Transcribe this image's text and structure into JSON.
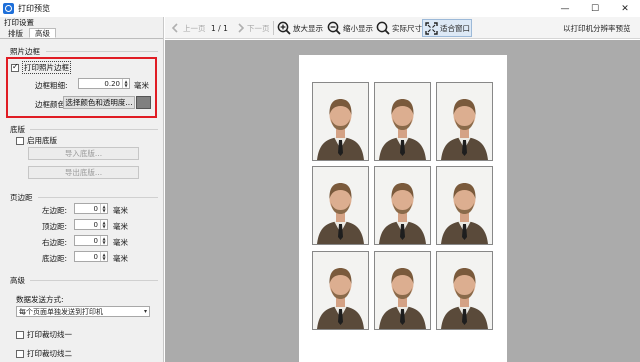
{
  "window": {
    "title": "打印预览",
    "minimize_glyph": "—",
    "maximize_glyph": "☐",
    "close_glyph": "✕"
  },
  "panel": {
    "title": "打印设置",
    "tabs": [
      {
        "label": "排版",
        "active": false
      },
      {
        "label": "高级",
        "active": true
      }
    ]
  },
  "photo_border": {
    "section_label": "照片边框",
    "checkbox_label": "打印照片边框",
    "checked": true,
    "thickness_label": "边框粗细:",
    "thickness_value": "0.20",
    "thickness_unit": "毫米",
    "color_label": "边框颜色:",
    "color_button": "选择颜色和透明度...",
    "swatch_color": "#808080"
  },
  "background": {
    "section_label": "底版",
    "checkbox_label": "启用底版",
    "checked": false,
    "import_button": "导入底版...",
    "export_button": "导出底版..."
  },
  "margins": {
    "section_label": "页边距",
    "rows": [
      {
        "label": "左边距:",
        "value": "0",
        "unit": "毫米"
      },
      {
        "label": "顶边距:",
        "value": "0",
        "unit": "毫米"
      },
      {
        "label": "右边距:",
        "value": "0",
        "unit": "毫米"
      },
      {
        "label": "底边距:",
        "value": "0",
        "unit": "毫米"
      }
    ]
  },
  "advanced": {
    "section_label": "高级",
    "send_mode_label": "数据发送方式:",
    "send_mode_value": "每个页面单独发送到打印机",
    "cut_line_1": "打印裁切线一",
    "cut_line_2": "打印裁切线二"
  },
  "toolbar": {
    "prev_page": "上一页",
    "page_indicator": "1 / 1",
    "next_page": "下一页",
    "zoom_in": "放大显示",
    "zoom_out": "缩小显示",
    "actual_size": "实际尺寸",
    "fit_window": "适合窗口",
    "printer_resolution": "以打印机分辨率预览"
  },
  "preview": {
    "page_color": "#ffffff",
    "background_color": "#ababab",
    "photo_grid": {
      "rows": 3,
      "cols": 3
    },
    "border_color": "#888888"
  }
}
